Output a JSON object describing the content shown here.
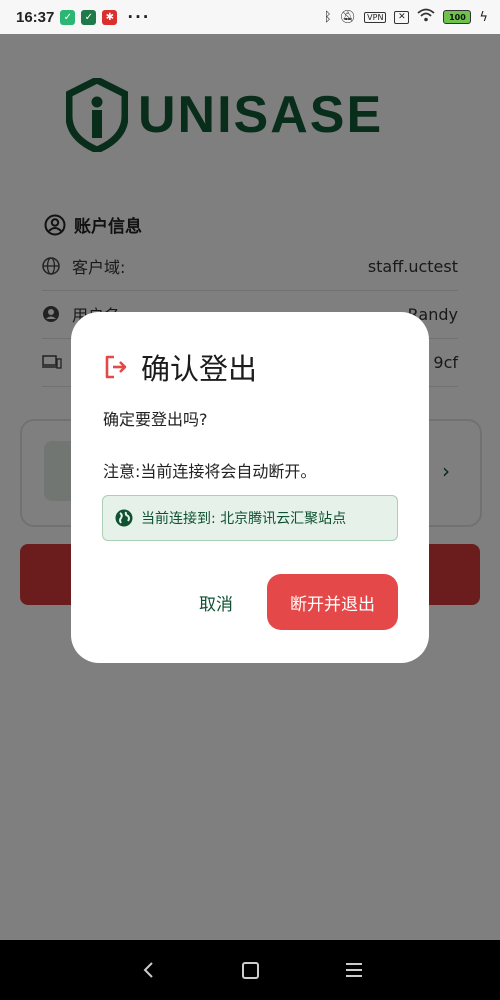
{
  "status_bar": {
    "time": "16:37",
    "more": "···",
    "vpn_label": "VPN",
    "battery": "100"
  },
  "app": {
    "logo_text": "UNISASE",
    "brand_color": "#135b36",
    "account_section_title": "账户信息",
    "rows": [
      {
        "label": "客户域:",
        "value": "staff.uctest",
        "icon": "globe-icon"
      },
      {
        "label": "用户名",
        "value": "Randy",
        "icon": "user-icon"
      },
      {
        "label": "",
        "value": "9cf",
        "icon": "devices-icon"
      }
    ]
  },
  "dialog": {
    "title": "确认登出",
    "question": "确定要登出吗?",
    "note": "注意:当前连接将会自动断开。",
    "connection_text": "当前连接到: 北京腾讯云汇聚站点",
    "cancel_label": "取消",
    "confirm_label": "断开并退出",
    "confirm_color": "#e54848"
  }
}
